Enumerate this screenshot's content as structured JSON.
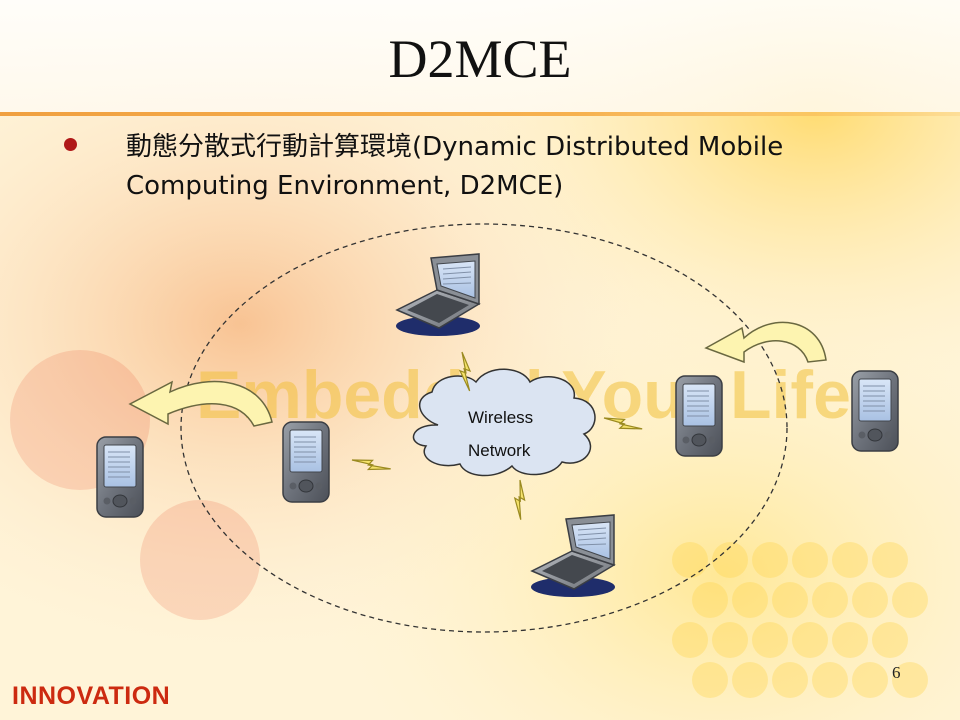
{
  "slide": {
    "title": "D2MCE",
    "bullet": "動態分散式行動計算環境(Dynamic Distributed Mobile Computing Environment, D2MCE)",
    "watermark": "Embedded Your Life !",
    "page_number": "6",
    "brand": "INNOVATION"
  },
  "diagram": {
    "cloud_line1": "Wireless",
    "cloud_line2": "Network",
    "devices": [
      "laptop-icon",
      "laptop-icon",
      "pda-icon",
      "pda-icon",
      "pda-icon",
      "pda-icon"
    ],
    "links": [
      "lightning-icon"
    ],
    "arrows": [
      "curved-arrow-icon"
    ]
  },
  "colors": {
    "accent": "#f6b14e",
    "brand_red": "#cc2a10",
    "bullet_red": "#b01818",
    "lightning": "#f5e26a",
    "cloud": "#dbe4f2",
    "arrow_fill": "#fdf4b0"
  }
}
